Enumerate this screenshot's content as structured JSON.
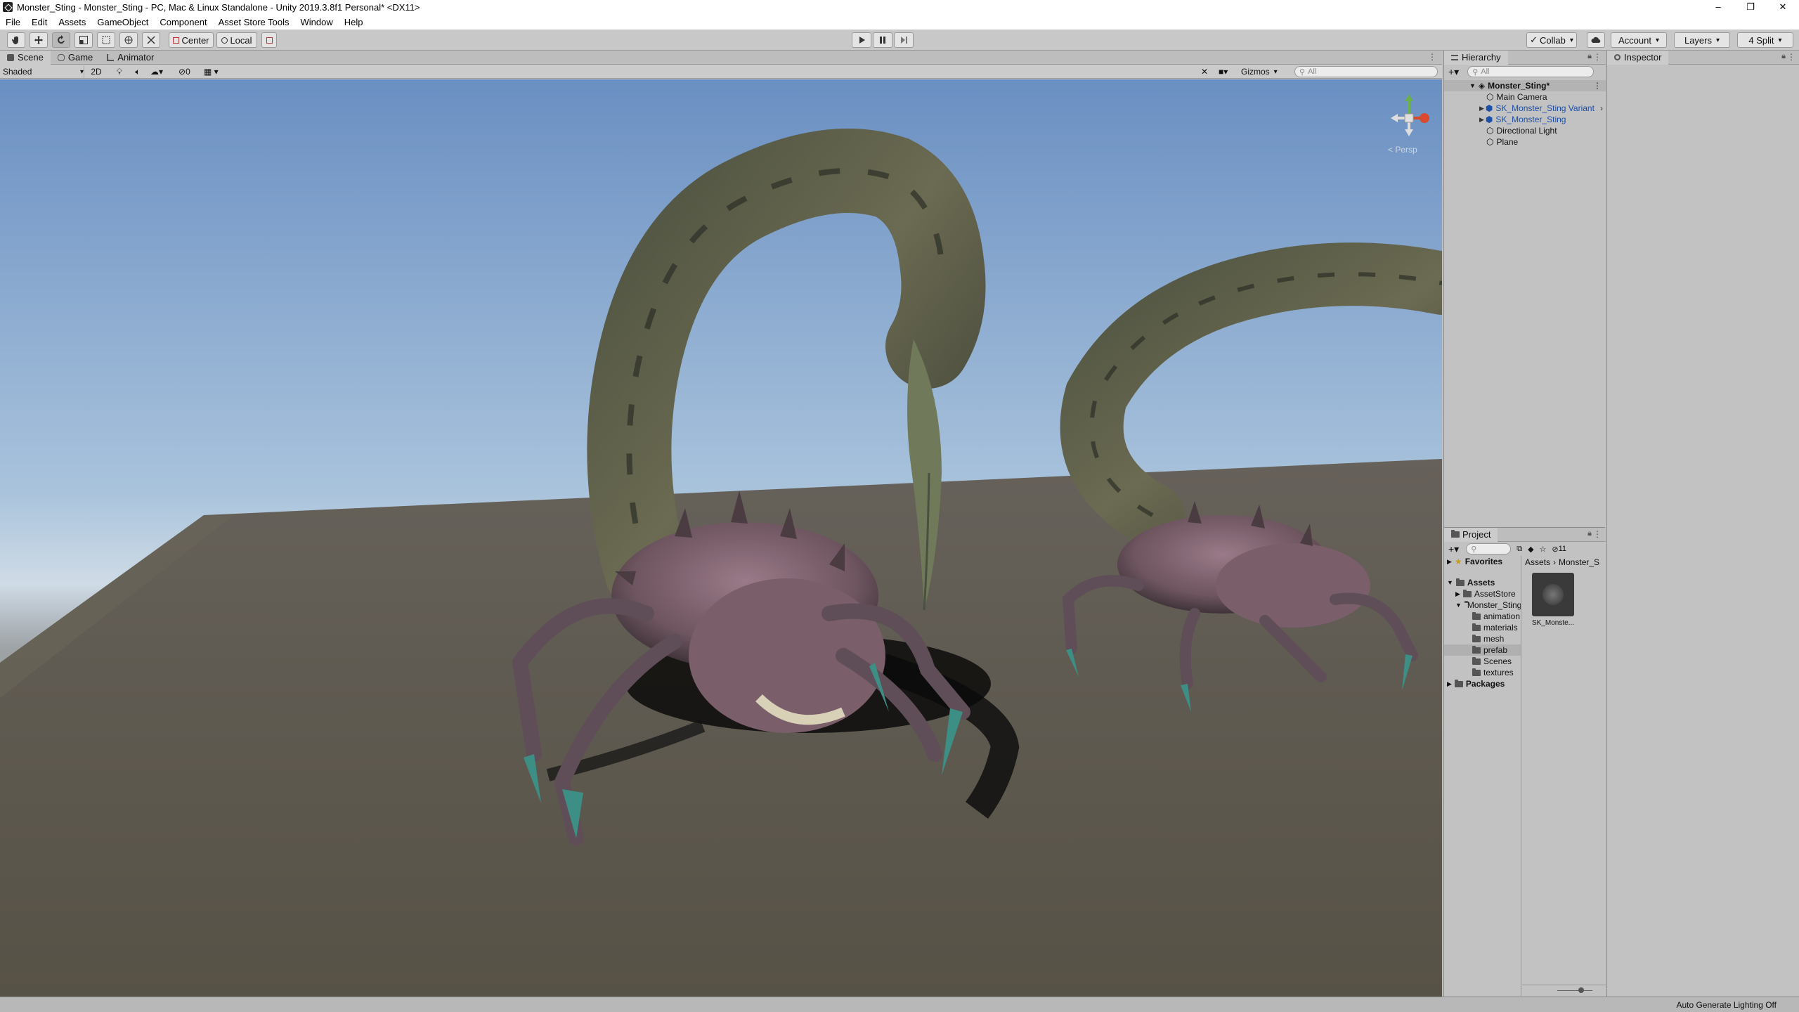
{
  "window": {
    "title": "Monster_Sting - Monster_Sting - PC, Mac & Linux Standalone - Unity 2019.3.8f1 Personal* <DX11>",
    "controls": [
      "–",
      "❐",
      "✕"
    ]
  },
  "menu": [
    "File",
    "Edit",
    "Assets",
    "GameObject",
    "Component",
    "Asset Store Tools",
    "Window",
    "Help"
  ],
  "toolbar": {
    "pivot_label": "Center",
    "space_label": "Local",
    "collab_label": "Collab",
    "account_label": "Account",
    "layers_label": "Layers",
    "layout_label": "4 Split"
  },
  "scene_tabs": [
    "Scene",
    "Game",
    "Animator"
  ],
  "scene_toolbar": {
    "shading_mode": "Shaded",
    "mode_2d": "2D",
    "hidden_count": "0",
    "gizmos_label": "Gizmos",
    "search_placeholder": "All",
    "persp_label": "< Persp"
  },
  "hierarchy": {
    "tab_label": "Hierarchy",
    "search_placeholder": "All",
    "scene_name": "Monster_Sting*",
    "items": [
      {
        "label": "Main Camera",
        "prefab": false,
        "expandable": false
      },
      {
        "label": "SK_Monster_Sting Variant",
        "prefab": true,
        "expandable": true
      },
      {
        "label": "SK_Monster_Sting",
        "prefab": true,
        "expandable": true
      },
      {
        "label": "Directional Light",
        "prefab": false,
        "expandable": false
      },
      {
        "label": "Plane",
        "prefab": false,
        "expandable": false
      }
    ]
  },
  "project": {
    "tab_label": "Project",
    "hidden_count": "11",
    "favorites_label": "Favorites",
    "assets_label": "Assets",
    "tree": [
      "AssetStore",
      "Monster_Sting",
      "animation",
      "materials",
      "mesh",
      "prefab",
      "Scenes",
      "textures"
    ],
    "packages_label": "Packages",
    "breadcrumb": [
      "Assets",
      "Monster_S"
    ],
    "asset_thumb_label": "SK_Monste..."
  },
  "inspector": {
    "tab_label": "Inspector"
  },
  "status": {
    "message": "Auto Generate Lighting Off"
  },
  "colors": {
    "sky_top": "#6e93c4",
    "sky_horizon": "#c9d9e8",
    "ground": "#5a564b",
    "prefab_text": "#1b4fa8",
    "play_tint": "#c2c2c2"
  }
}
